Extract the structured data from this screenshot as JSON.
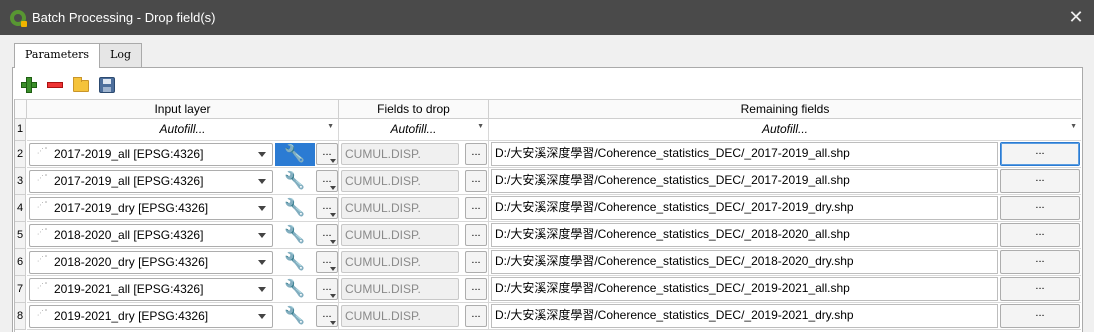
{
  "window": {
    "title": "Batch Processing - Drop field(s)",
    "close_glyph": "✕"
  },
  "tabs": [
    {
      "label": "Parameters"
    },
    {
      "label": "Log"
    }
  ],
  "toolbar": {
    "icons": [
      "add-row-icon",
      "remove-row-icon",
      "open-icon",
      "save-icon"
    ]
  },
  "table": {
    "headers": {
      "input": "Input layer",
      "fields": "Fields to drop",
      "remaining": "Remaining fields"
    },
    "autofill": "Autofill...",
    "ellipsis": "...",
    "rows": [
      {
        "num": "2",
        "layer": "2017-2019_all [EPSG:4326]",
        "fields": "CUMUL.DISP.",
        "path": "D:/大安溪深度學習/Coherence_statistics_DEC/_2017-2019_all.shp"
      },
      {
        "num": "3",
        "layer": "2017-2019_all [EPSG:4326]",
        "fields": "CUMUL.DISP.",
        "path": "D:/大安溪深度學習/Coherence_statistics_DEC/_2017-2019_all.shp"
      },
      {
        "num": "4",
        "layer": "2017-2019_dry [EPSG:4326]",
        "fields": "CUMUL.DISP.",
        "path": "D:/大安溪深度學習/Coherence_statistics_DEC/_2017-2019_dry.shp"
      },
      {
        "num": "5",
        "layer": "2018-2020_all [EPSG:4326]",
        "fields": "CUMUL.DISP.",
        "path": "D:/大安溪深度學習/Coherence_statistics_DEC/_2018-2020_all.shp"
      },
      {
        "num": "6",
        "layer": "2018-2020_dry [EPSG:4326]",
        "fields": "CUMUL.DISP.",
        "path": "D:/大安溪深度學習/Coherence_statistics_DEC/_2018-2020_dry.shp"
      },
      {
        "num": "7",
        "layer": "2019-2021_all [EPSG:4326]",
        "fields": "CUMUL.DISP.",
        "path": "D:/大安溪深度學習/Coherence_statistics_DEC/_2019-2021_all.shp"
      },
      {
        "num": "8",
        "layer": "2019-2021_dry [EPSG:4326]",
        "fields": "CUMUL.DISP.",
        "path": "D:/大安溪深度學習/Coherence_statistics_DEC/_2019-2021_dry.shp"
      }
    ]
  },
  "colors": {
    "titlebar": "#4a4a4a",
    "selection": "#2b7bd3",
    "qgis_green": "#589632"
  }
}
